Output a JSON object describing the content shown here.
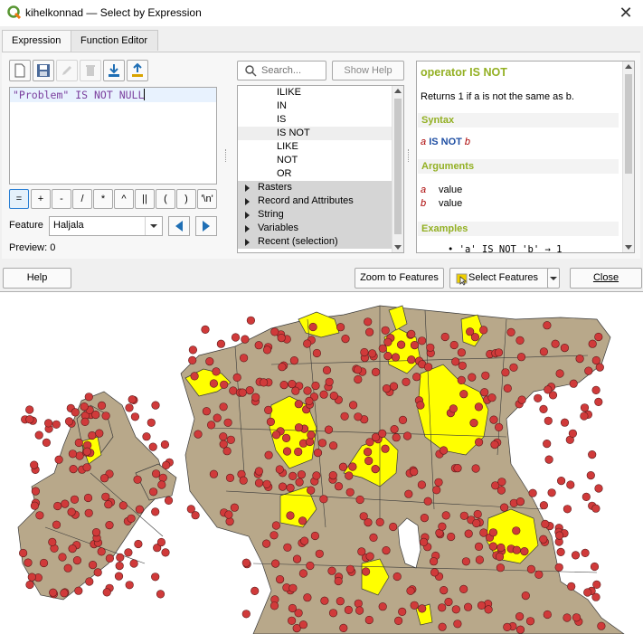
{
  "window": {
    "title": "kihelkonnad — Select by Expression"
  },
  "tabs": [
    {
      "label": "Expression"
    },
    {
      "label": "Function Editor"
    }
  ],
  "editor": {
    "field": "\"Problem\"",
    "keyword": " IS NOT NULL"
  },
  "operators": [
    "=",
    "+",
    "-",
    "/",
    "*",
    "^",
    "||",
    "(",
    ")",
    "'\\n'"
  ],
  "feature": {
    "label": "Feature",
    "value": "Haljala"
  },
  "preview": {
    "label": "Preview:",
    "value": "0"
  },
  "search": {
    "placeholder": "Search..."
  },
  "show_help_label": "Show Help",
  "function_tree": {
    "items": [
      "ILIKE",
      "IN",
      "IS",
      "IS NOT",
      "LIKE",
      "NOT",
      "OR"
    ],
    "groups": [
      "Rasters",
      "Record and Attributes",
      "String",
      "Variables",
      "Recent (selection)"
    ]
  },
  "help_panel": {
    "title": "operator IS NOT",
    "description": "Returns 1 if a is not the same as b.",
    "syntax_heading": "Syntax",
    "syntax_a": "a",
    "syntax_op": "IS NOT",
    "syntax_b": "b",
    "arguments_heading": "Arguments",
    "arg1_name": "a",
    "arg1_desc": "value",
    "arg2_name": "b",
    "arg2_desc": "value",
    "examples_heading": "Examples",
    "example_text": "• 'a' IS NOT 'b' → 1"
  },
  "buttons": {
    "help": "Help",
    "zoom": "Zoom to Features",
    "select": "Select Features",
    "close": "Close"
  },
  "colors": {
    "polygon_fill": "#b8a88a",
    "selected_fill": "#ffff00",
    "point_fill": "#d03a3a",
    "accent": "#93b023"
  }
}
